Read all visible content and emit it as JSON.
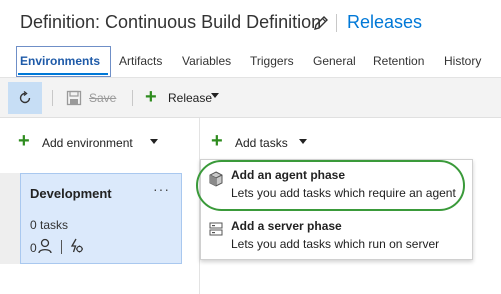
{
  "header": {
    "title": "Definition: Continuous Build Definition",
    "releases_link": "Releases"
  },
  "tabs": [
    {
      "label": "Environments",
      "active": true
    },
    {
      "label": "Artifacts"
    },
    {
      "label": "Variables"
    },
    {
      "label": "Triggers"
    },
    {
      "label": "General"
    },
    {
      "label": "Retention"
    },
    {
      "label": "History"
    }
  ],
  "toolbar": {
    "save_label": "Save",
    "release_label": "Release"
  },
  "environments": {
    "add_label": "Add environment",
    "card": {
      "name": "Development",
      "more": "···",
      "tasks": "0 tasks",
      "approvers_count": "0"
    }
  },
  "tasks": {
    "add_label": "Add tasks",
    "menu": [
      {
        "title": "Add an agent phase",
        "description": "Lets you add tasks which require an agent",
        "icon": "agent-phase-icon"
      },
      {
        "title": "Add a server phase",
        "description": "Lets you add tasks which run on server",
        "icon": "server-phase-icon"
      }
    ]
  },
  "colors": {
    "accent": "#0078d7",
    "add_green": "#2f8c1f",
    "card_bg": "#dbe9fb",
    "highlight": "#3a9a3a"
  }
}
